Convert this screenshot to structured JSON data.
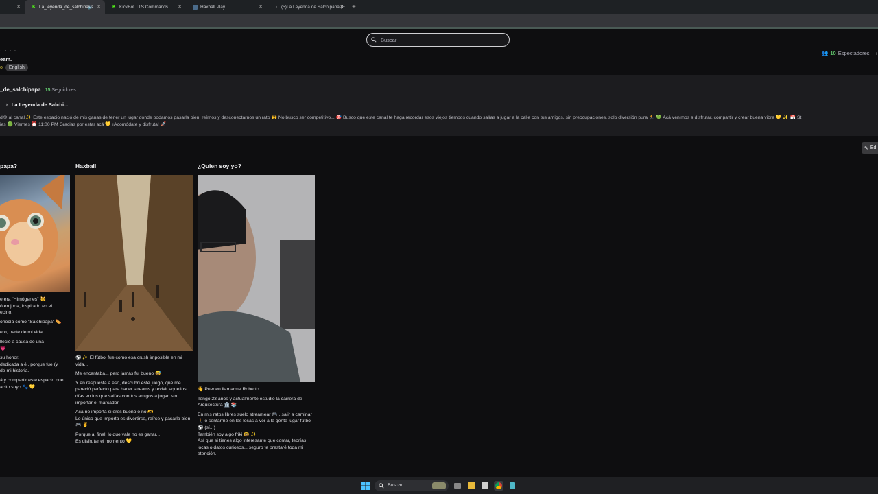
{
  "browser": {
    "tabs": [
      {
        "label": "",
        "active": false
      },
      {
        "label": "La_leyenda_de_salchipapa",
        "active": true,
        "icon": "kick-icon"
      },
      {
        "label": "KickBot TTS Commands",
        "active": false,
        "icon": "kick-icon"
      },
      {
        "label": "Haxball Play",
        "active": false,
        "icon": "haxball-icon"
      },
      {
        "label": "(5)La Leyenda de Salchipapa (E",
        "active": false,
        "icon": "tiktok-icon"
      }
    ],
    "new_tab": "+"
  },
  "header": {
    "search_placeholder": "Buscar",
    "viewers_count": "10",
    "viewers_label": "Espectadores",
    "stream_title_cut": "eam.",
    "category_cut": "o",
    "language_tag": "English"
  },
  "about": {
    "channel_name": "_de_salchipapa",
    "followers_count": "15",
    "followers_label": "Seguidores",
    "link_label": "La Leyenda de Salchi...",
    "description_line1": "d@ al canal ✨ Este espacio nació de mis ganas de tener un lugar donde podamos pasarla bien, reírnos y desconectarnos un rato 🙌 No busco ser competitivo... 🎯 Busco que este canal te haga recordar esos viejos tiempos cuando salías a jugar a la calle con tus amigos, sin preocupaciones, solo diversión pura 🏃 💚 Acá venimos a disfrutar, compartir y crear buena vibra 💛 ✨ 📅 St",
    "description_line2": "ies 🟢 Viernes ⏰ 11:00 PM Gracias por estar acá 💛 ¡Acomódate y disfruta! 🚀",
    "edit_label": "Ed"
  },
  "panels": [
    {
      "title": "papa?",
      "paragraphs": [
        "e era \"Himógenes\" 🐱",
        "ó en joda, inspirado en el",
        "ecino.",
        "onocía como \"Salchipapa\" 🌭",
        "ero, parte de mi vida.",
        "lleció a causa de una",
        "💗",
        "su honor.",
        "dedicada a él, porque fue (y",
        "de mi historia.",
        "á y compartir este espacio que",
        "acito suyo 🐾 💛"
      ]
    },
    {
      "title": "Haxball",
      "paragraphs": [
        "⚽ ✨ El fútbol fue como esa crush imposible en mi vida...",
        "Me encantaba... pero jamás fui bueno 😅",
        "Y en respuesta a eso, descubrí este juego, que me pareció perfecto para hacer streams y revivir aquellos días en los que salías con tus amigos a jugar, sin importar el marcador.",
        "Acá no importa si eres bueno o no 🫶\nLo único que importa es divertirse, reírse y pasarla bien 🎮 ✌",
        "Porque al final, lo que vale no es ganar...\nEs disfrutar el momento 💛"
      ]
    },
    {
      "title": "¿Quien soy yo?",
      "paragraphs": [
        "👋 Pueden llamarme Roberto",
        "Tengo 23 años y actualmente estudio la carrera de Arquitectura 🏛️ 📚",
        "En mis ratos libres suelo streamear 🎮 , salir a caminar 🚶 o sentarme en las losas a ver a la gente jugar fútbol ⚽ (sí...)\nTambién soy algo friki 🤓 ✨\nAsí que si tienes algo interesante que contar, teorías locas o datos curiosos... seguro te prestaré toda mi atención."
      ]
    }
  ],
  "taskbar": {
    "search_placeholder": "Buscar"
  },
  "colors": {
    "accent_green": "#5ec26a",
    "page_bg": "#0e0e10",
    "panel_bg": "#1c1c1f"
  }
}
